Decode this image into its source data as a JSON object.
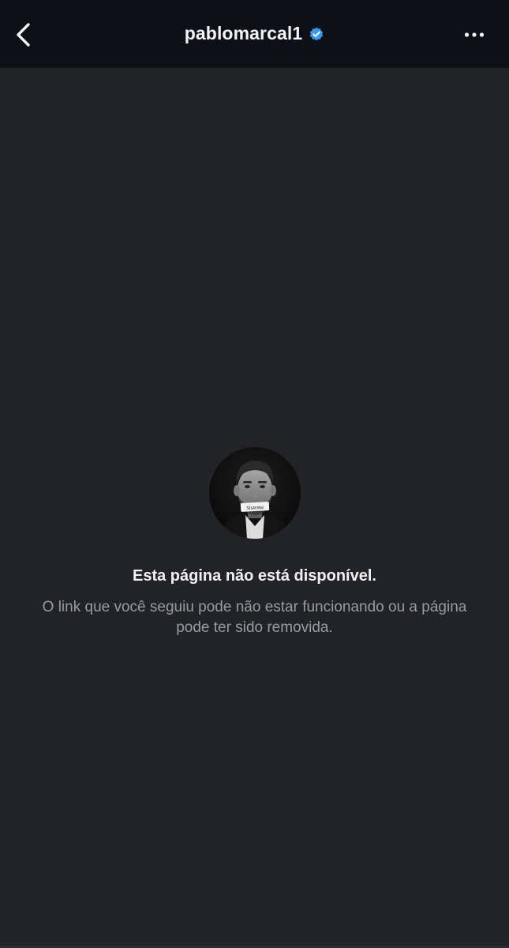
{
  "header": {
    "username": "pablomarcal1",
    "back_icon": "chevron-left-icon",
    "verified_icon": "verified-badge-icon",
    "more_icon": "more-horizontal-icon"
  },
  "main": {
    "avatar_icon": "profile-avatar",
    "mouth_tape_text": "Sistema",
    "title": "Esta página não está disponível.",
    "message": "O link que você seguiu pode não estar funcionando ou a página pode ter sido removida."
  },
  "colors": {
    "header_bg": "#0d1016",
    "page_bg": "#222327",
    "verified_blue": "#3897f0",
    "text_primary": "#f2f2f2",
    "text_secondary": "#9a9ba2"
  }
}
